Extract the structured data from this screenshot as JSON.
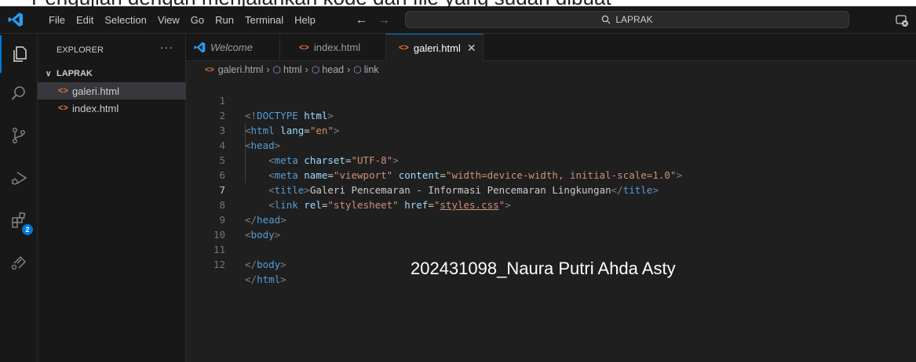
{
  "caption": "Pengujian dengan menjalankan kode dari file yang sudah dibuat",
  "titlebar": {
    "menu": [
      "File",
      "Edit",
      "Selection",
      "View",
      "Go",
      "Run",
      "Terminal",
      "Help"
    ],
    "search": "LAPRAK"
  },
  "activity": {
    "extensions_badge": "2"
  },
  "sidebar": {
    "title": "EXPLORER",
    "more": "···",
    "folder": "LAPRAK",
    "files": [
      "galeri.html",
      "index.html"
    ]
  },
  "tabs": [
    {
      "label": "Welcome"
    },
    {
      "label": "index.html"
    },
    {
      "label": "galeri.html"
    }
  ],
  "breadcrumb": {
    "file": "galeri.html",
    "items": [
      "html",
      "head",
      "link"
    ]
  },
  "editor": {
    "line_numbers": [
      "1",
      "2",
      "3",
      "4",
      "5",
      "6",
      "7",
      "8",
      "9",
      "10",
      "11",
      "12"
    ],
    "current_line": 7,
    "strings": {
      "doctype": "<!DOCTYPE html>",
      "html_open": "html",
      "lang_attr": "lang",
      "lang_val": "\"en\"",
      "head": "head",
      "meta": "meta",
      "charset": "charset",
      "charset_val": "\"UTF-8\"",
      "name": "name",
      "name_val": "\"viewport\"",
      "content": "content",
      "content_val": "\"width=device-width, initial-scale=1.0\"",
      "title": "title",
      "title_text": "Galeri Pencemaran - Informasi Pencemaran Lingkungan",
      "link": "link",
      "rel": "rel",
      "rel_val": "\"stylesheet\"",
      "href": "href",
      "href_val": "styles.css",
      "body": "body"
    }
  },
  "watermark": "202431098_Naura Putri Ahda Asty"
}
